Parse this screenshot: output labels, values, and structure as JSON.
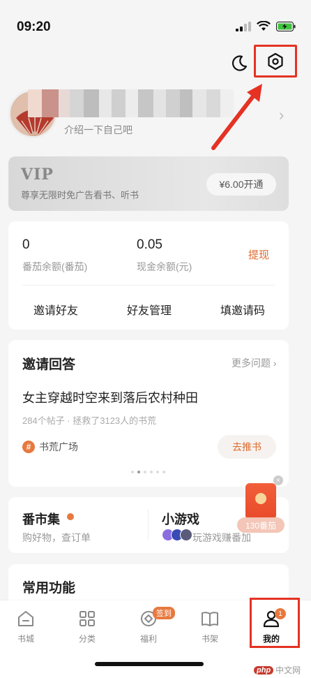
{
  "status_bar": {
    "time": "09:20"
  },
  "profile": {
    "subtitle": "介绍一下自己吧"
  },
  "vip": {
    "title": "VIP",
    "subtitle": "尊享无限时免广告看书、听书",
    "button": "¥6.00开通"
  },
  "wallet": {
    "tomato_balance_value": "0",
    "tomato_balance_label": "番茄余额(番茄)",
    "cash_balance_value": "0.05",
    "cash_balance_label": "现金余额(元)",
    "withdraw": "提现",
    "actions": [
      "邀请好友",
      "好友管理",
      "填邀请码"
    ]
  },
  "invite_answers": {
    "title": "邀请回答",
    "more": "更多问题",
    "question": "女主穿越时空来到落后农村种田",
    "meta": "284个帖子 · 拯救了3123人的书荒",
    "tag": "书荒广场",
    "button": "去推书"
  },
  "market": {
    "title": "番市集",
    "subtitle": "购好物，查订单"
  },
  "games": {
    "title": "小游戏",
    "subtitle": "玩游戏赚番加"
  },
  "red_packet": {
    "badge": "130番茄"
  },
  "common": {
    "title": "常用功能"
  },
  "tabs": [
    {
      "label": "书城",
      "icon": "home-icon"
    },
    {
      "label": "分类",
      "icon": "grid-icon"
    },
    {
      "label": "福利",
      "icon": "coin-icon",
      "badge": "签到"
    },
    {
      "label": "书架",
      "icon": "book-icon"
    },
    {
      "label": "我的",
      "icon": "person-icon",
      "badge": "1",
      "active": true
    }
  ],
  "watermark": {
    "logo": "php",
    "text": "中文网"
  },
  "colors": {
    "accent": "#e06a2f",
    "annotation_red": "#e53223"
  }
}
